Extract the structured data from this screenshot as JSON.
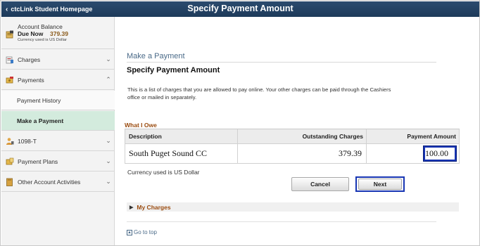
{
  "header": {
    "back_label": "ctcLink Student Homepage",
    "title": "Specify Payment Amount"
  },
  "sidebar": {
    "account": {
      "title": "Account Balance",
      "due_label": "Due Now",
      "due_amount": "379.39",
      "currency_note": "Currency used is US Dollar"
    },
    "items": [
      {
        "label": "Charges",
        "icon": "charges-icon",
        "state": "collapsed"
      },
      {
        "label": "Payments",
        "icon": "payments-icon",
        "state": "expanded"
      },
      {
        "label": "1098-T",
        "icon": "person-icon",
        "state": "collapsed"
      },
      {
        "label": "Payment Plans",
        "icon": "payment-plans-icon",
        "state": "collapsed"
      },
      {
        "label": "Other Account Activities",
        "icon": "folder-icon",
        "state": "collapsed"
      }
    ],
    "sub_items": [
      {
        "label": "Payment History",
        "active": false
      },
      {
        "label": "Make a Payment",
        "active": true
      }
    ]
  },
  "main": {
    "section_title": "Make a Payment",
    "page_heading": "Specify Payment Amount",
    "info_text": "This is a list of charges that you are allowed to pay online. Your other charges can be paid through the Cashiers office or mailed in separately.",
    "owe_label": "What I Owe",
    "table": {
      "headers": [
        "Description",
        "Outstanding Charges",
        "Payment Amount"
      ],
      "rows": [
        {
          "description": "South Puget Sound CC",
          "outstanding": "379.39",
          "payment": "100.00"
        }
      ]
    },
    "currency_text": "Currency used is US Dollar",
    "cancel_label": "Cancel",
    "next_label": "Next",
    "my_charges_label": "My Charges",
    "go_to_top_label": "Go to top"
  },
  "colors": {
    "header_bg": "#1d3a5a",
    "accent_orange": "#9a4b0f",
    "highlight_blue": "#1735b3",
    "active_nav_bg": "#d3ebdd"
  }
}
